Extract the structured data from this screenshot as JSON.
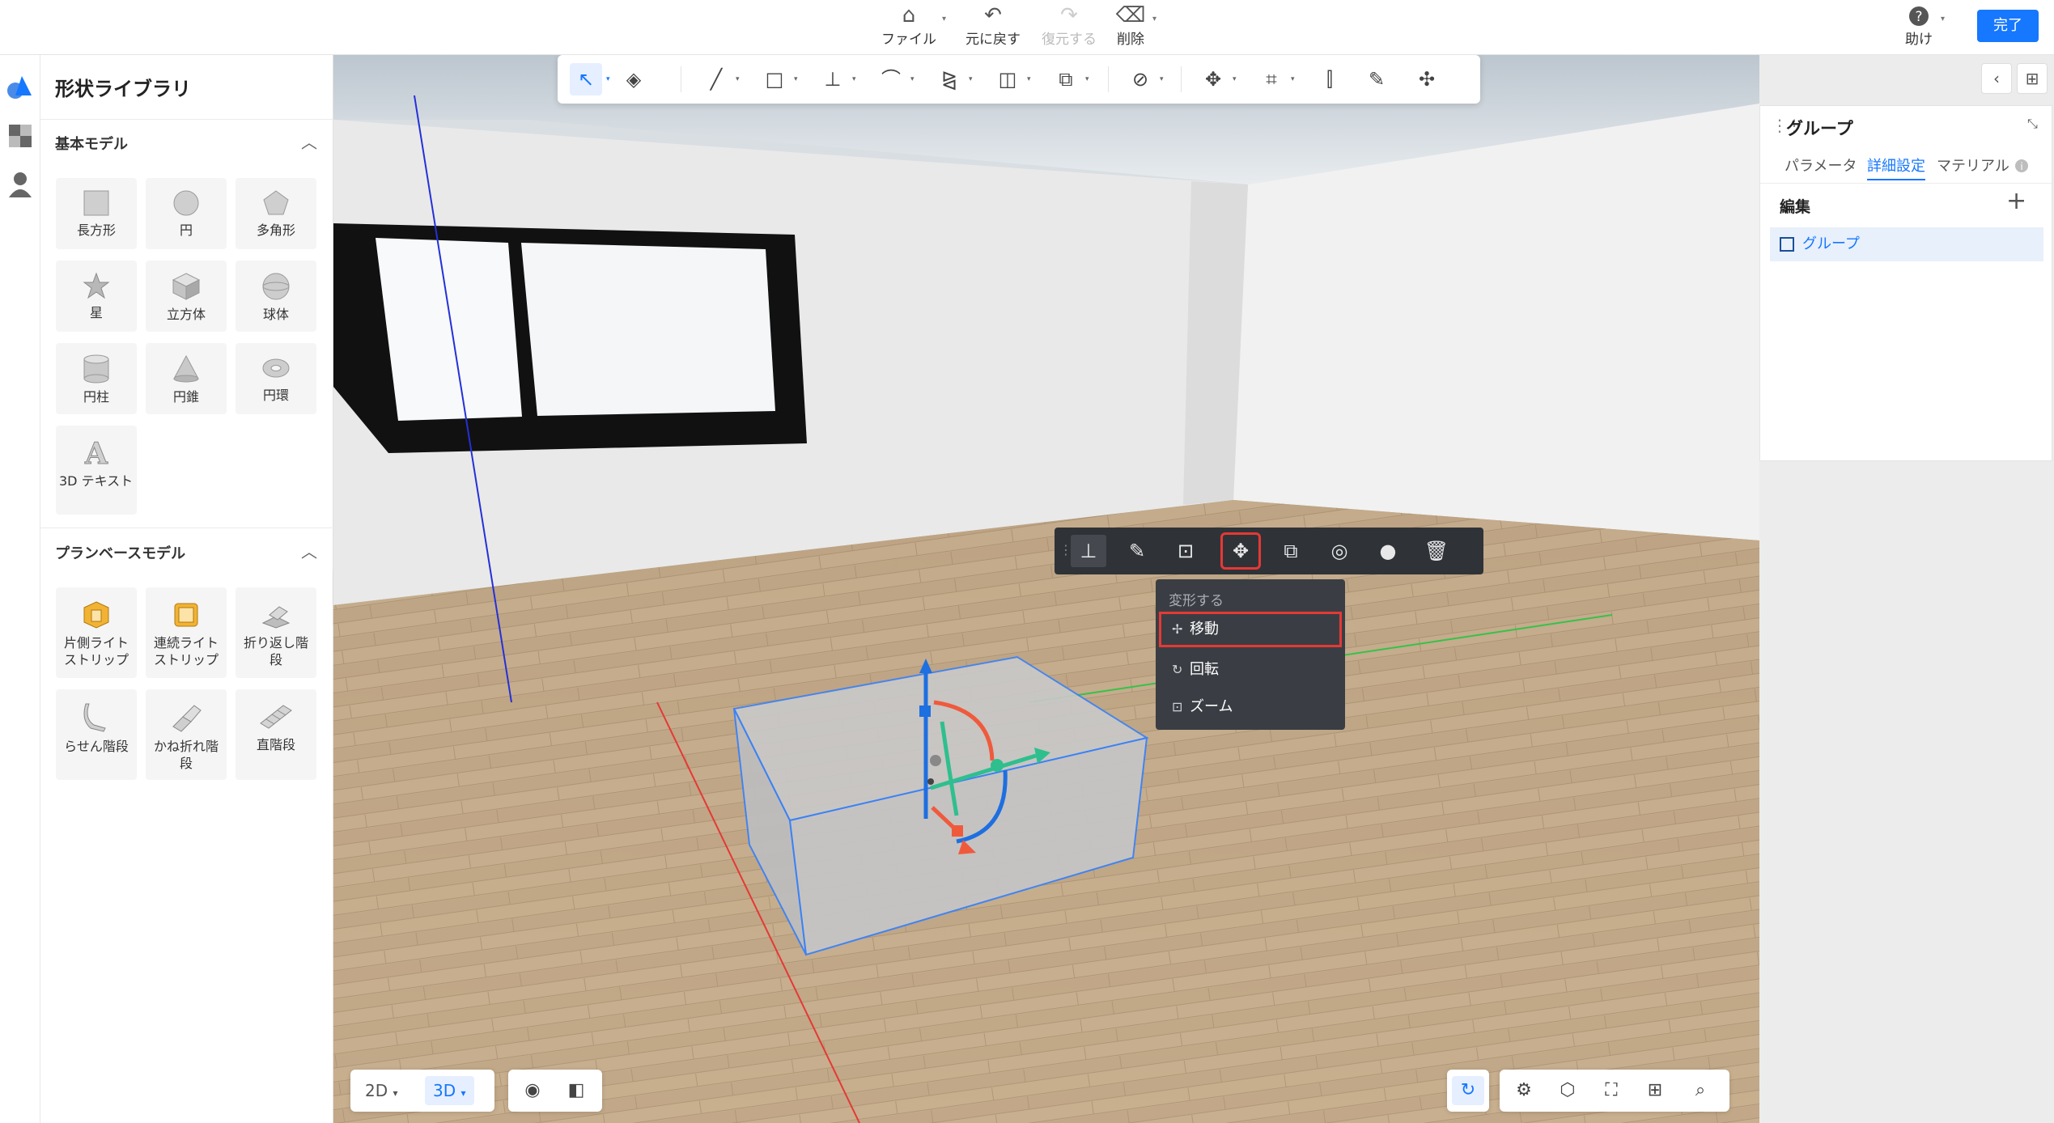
{
  "topbar": {
    "file_label": "ファイル",
    "undo_label": "元に戻す",
    "redo_label": "復元する",
    "delete_label": "削除",
    "help_label": "助け",
    "done_label": "完了"
  },
  "library": {
    "title": "形状ライブラリ",
    "basic_section": {
      "title": "基本モデル",
      "items": [
        "長方形",
        "円",
        "多角形",
        "星",
        "立方体",
        "球体",
        "円柱",
        "円錐",
        "円環",
        "3D テキスト"
      ]
    },
    "plan_section": {
      "title": "プランベースモデル",
      "items": [
        "片側ライトストリップ",
        "連続ライトストリップ",
        "折り返し階段",
        "らせん階段",
        "かね折れ階段",
        "直階段"
      ]
    }
  },
  "transform_menu": {
    "header": "変形する",
    "items": [
      {
        "label": "移動",
        "icon": "move-icon",
        "highlighted": true
      },
      {
        "label": "回転",
        "icon": "rotate-icon"
      },
      {
        "label": "ズーム",
        "icon": "zoom-icon"
      }
    ]
  },
  "view_switch": {
    "options": [
      "2D",
      "3D"
    ],
    "selected": "3D"
  },
  "group_panel": {
    "title": "グループ",
    "tabs": [
      "パラメータ",
      "詳細設定",
      "マテリアル"
    ],
    "selected_tab": "詳細設定",
    "edit_label": "編集",
    "items": [
      "グループ"
    ]
  },
  "colors": {
    "accent": "#1677ff",
    "highlight_red": "#e53935",
    "context_toolbar_bg": "#2f3338",
    "selection_box": "#3b82f6"
  }
}
